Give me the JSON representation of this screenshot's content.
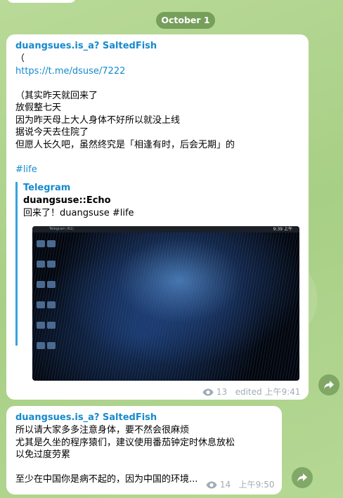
{
  "date_separator": "October 1",
  "messages": [
    {
      "sender": "duangsues.is_a? SaltedFish",
      "lines": [
        "（",
        "https://t.me/dsuse/7222",
        "",
        "（其实昨天就回来了",
        "放假整七天",
        "因为昨天母上大人身体不好所以就没上线",
        "据说今天去住院了",
        "但愿人长久吧，虽然终究是「相逢有时，后会无期」的",
        "",
        "#life"
      ],
      "forward": {
        "source": "Telegram",
        "author": "duangsuse::Echo",
        "text": "回来了！duangsuse #life",
        "screenshot": {
          "clock": "9:39 上午",
          "tab_text": "Telegram (61)"
        }
      },
      "views": "13",
      "edited": "edited",
      "time": "上午9:41"
    },
    {
      "sender": "duangsues.is_a? SaltedFish",
      "lines": [
        "所以请大家多多注意身体，要不然会很麻烦",
        "尤其是久坐的程序猿们，建议使用番茄钟定时休息放松",
        "以免过度劳累",
        "",
        "至少在中国你是病不起的，因为中国的环境..."
      ],
      "views": "14",
      "time": "上午9:50"
    }
  ],
  "colors": {
    "accent": "#168acd",
    "meta": "#a0acb6",
    "date_pill": "#628c4a"
  }
}
